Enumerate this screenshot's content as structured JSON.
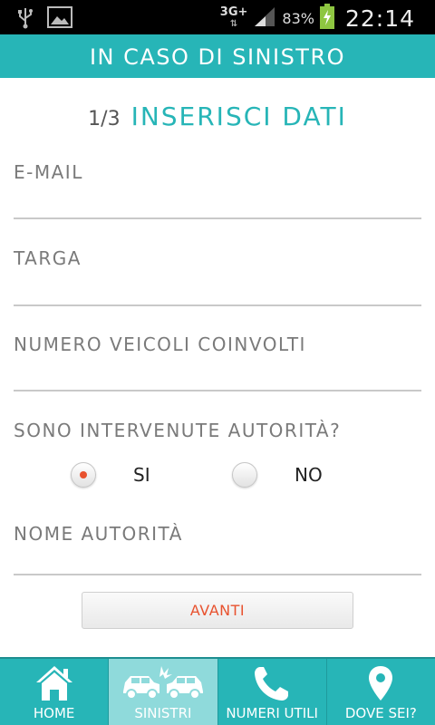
{
  "status_bar": {
    "network": "3G+",
    "network_arrows": "⇅",
    "battery_percent": "83%",
    "time": "22:14"
  },
  "header": {
    "title": "IN CASO DI SINISTRO"
  },
  "step": {
    "fraction": "1/3",
    "title": "INSERISCI DATI"
  },
  "form": {
    "email_label": "E-MAIL",
    "targa_label": "TARGA",
    "numero_veicoli_label": "NUMERO VEICOLI COINVOLTI",
    "autorita_question": "SONO INTERVENUTE AUTORITÀ?",
    "radio_si": "SI",
    "radio_no": "NO",
    "selected": "SI",
    "nome_autorita_label": "NOME AUTORITÀ",
    "avanti_button": "AVANTI"
  },
  "tabs": [
    {
      "label": "HOME",
      "icon": "home-icon"
    },
    {
      "label": "SINISTRI",
      "icon": "car-crash-icon",
      "active": true
    },
    {
      "label": "NUMERI UTILI",
      "icon": "phone-icon"
    },
    {
      "label": "DOVE SEI?",
      "icon": "location-pin-icon"
    }
  ],
  "colors": {
    "accent": "#27b5b7",
    "active_tab": "#8fdadb",
    "button_text": "#e8522f",
    "label_text": "#7a7a7a"
  }
}
